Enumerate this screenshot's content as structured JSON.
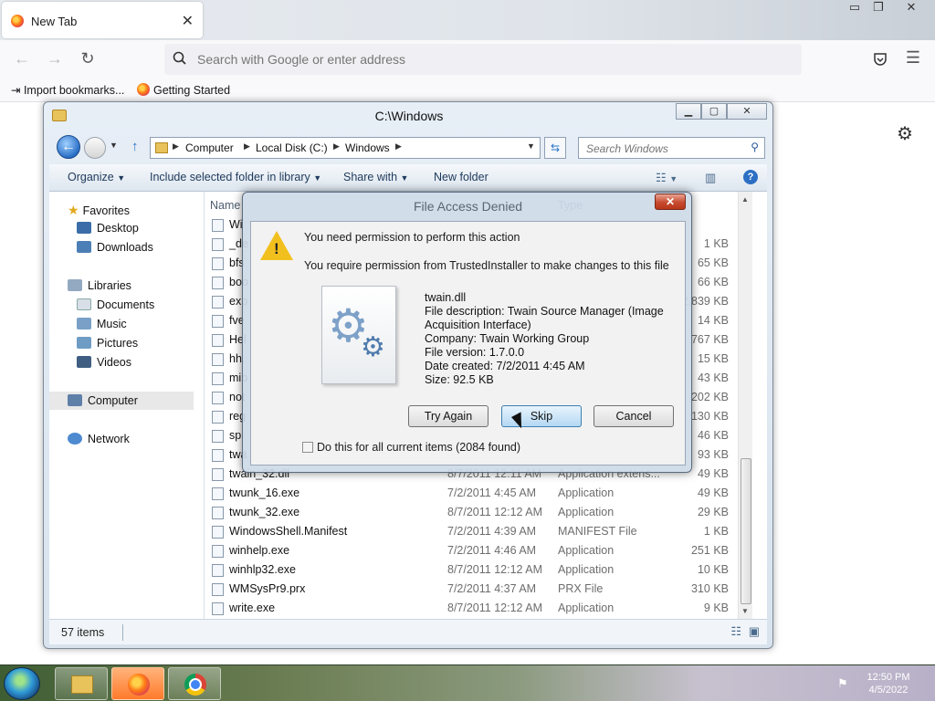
{
  "browser": {
    "tab": {
      "title": "New Tab"
    },
    "urlbar": {
      "placeholder": "Search with Google or enter address"
    },
    "bookmarks": [
      {
        "label": "Import bookmarks..."
      },
      {
        "label": "Getting Started"
      }
    ]
  },
  "explorer": {
    "title": "C:\\Windows",
    "breadcrumb": [
      "Computer",
      "Local Disk (C:)",
      "Windows"
    ],
    "search_placeholder": "Search Windows",
    "toolbar": {
      "organize": "Organize",
      "include": "Include selected folder in library",
      "share": "Share with",
      "new_folder": "New folder"
    },
    "nav": {
      "favorites": "Favorites",
      "desktop": "Desktop",
      "downloads": "Downloads",
      "libraries": "Libraries",
      "documents": "Documents",
      "music": "Music",
      "pictures": "Pictures",
      "videos": "Videos",
      "computer": "Computer",
      "network": "Network"
    },
    "columns": {
      "name": "Name",
      "type": "Type"
    },
    "files": [
      {
        "name": "Wi",
        "date": "",
        "type": "",
        "size": ""
      },
      {
        "name": "_de",
        "date": "",
        "type": "",
        "size": "1 KB"
      },
      {
        "name": "bfs",
        "date": "",
        "type": "",
        "size": "65 KB"
      },
      {
        "name": "boo",
        "date": "",
        "type": "",
        "size": "66 KB"
      },
      {
        "name": "exp",
        "date": "",
        "type": "",
        "size": "2,839 KB"
      },
      {
        "name": "fve",
        "date": "",
        "type": "",
        "size": "14 KB"
      },
      {
        "name": "Hel",
        "date": "",
        "type": "",
        "size": "767 KB"
      },
      {
        "name": "hh.",
        "date": "",
        "type": "",
        "size": "15 KB"
      },
      {
        "name": "mib",
        "date": "",
        "type": "",
        "size": "43 KB"
      },
      {
        "name": "not",
        "date": "",
        "type": "",
        "size": "202 KB"
      },
      {
        "name": "reg",
        "date": "",
        "type": "",
        "size": "130 KB"
      },
      {
        "name": "spl",
        "date": "",
        "type": "",
        "size": "46 KB"
      },
      {
        "name": "twa",
        "date": "",
        "type": "",
        "size": "93 KB"
      },
      {
        "name": "twain_32.dll",
        "date": "8/7/2011 12:11 AM",
        "type": "Application extens...",
        "size": "49 KB"
      },
      {
        "name": "twunk_16.exe",
        "date": "7/2/2011 4:45 AM",
        "type": "Application",
        "size": "49 KB"
      },
      {
        "name": "twunk_32.exe",
        "date": "8/7/2011 12:12 AM",
        "type": "Application",
        "size": "29 KB"
      },
      {
        "name": "WindowsShell.Manifest",
        "date": "7/2/2011 4:39 AM",
        "type": "MANIFEST File",
        "size": "1 KB"
      },
      {
        "name": "winhelp.exe",
        "date": "7/2/2011 4:46 AM",
        "type": "Application",
        "size": "251 KB"
      },
      {
        "name": "winhlp32.exe",
        "date": "8/7/2011 12:12 AM",
        "type": "Application",
        "size": "10 KB"
      },
      {
        "name": "WMSysPr9.prx",
        "date": "7/2/2011 4:37 AM",
        "type": "PRX File",
        "size": "310 KB"
      },
      {
        "name": "write.exe",
        "date": "8/7/2011 12:12 AM",
        "type": "Application",
        "size": "9 KB"
      }
    ],
    "status": {
      "items": "57 items"
    }
  },
  "dialog": {
    "title": "File Access Denied",
    "message": "You need permission to perform this action",
    "submessage": "You require permission from TrustedInstaller to make changes to this file",
    "file": {
      "name": "twain.dll",
      "description1": "File description: Twain Source Manager (Image",
      "description2": "Acquisition Interface)",
      "company": "Company: Twain Working Group",
      "version": "File version: 1.7.0.0",
      "created": "Date created: 7/2/2011 4:45 AM",
      "size": "Size: 92.5 KB"
    },
    "buttons": {
      "try_again": "Try Again",
      "skip": "Skip",
      "cancel": "Cancel"
    },
    "checkbox_label": "Do this for all current items (2084 found)"
  },
  "taskbar": {
    "time": "12:50 PM",
    "date": "4/5/2022"
  }
}
